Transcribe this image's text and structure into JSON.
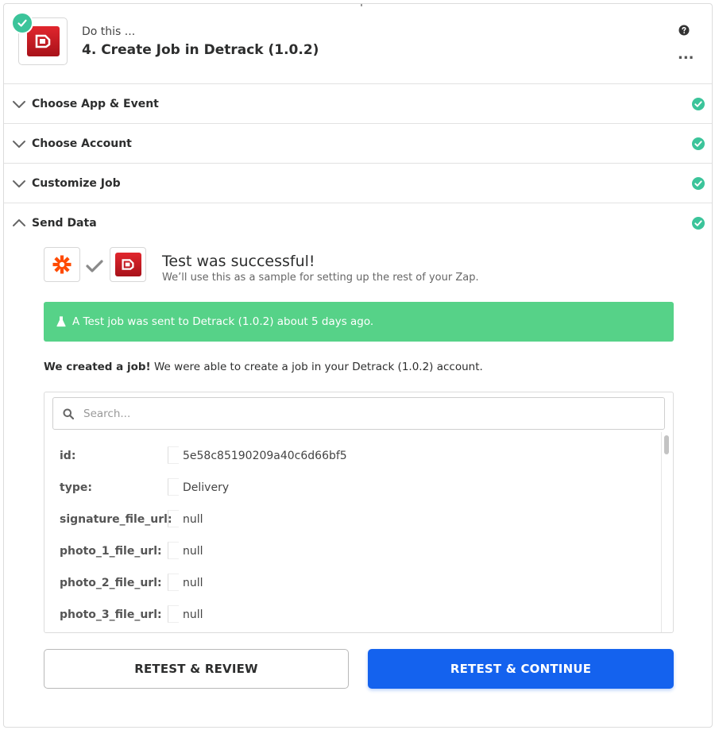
{
  "step": {
    "prefix": "Do this ...",
    "title": "4. Create Job in Detrack (1.0.2)",
    "more_label": "..."
  },
  "sections": [
    {
      "label": "Choose App & Event",
      "state": "collapsed",
      "complete": true
    },
    {
      "label": "Choose Account",
      "state": "collapsed",
      "complete": true
    },
    {
      "label": "Customize Job",
      "state": "collapsed",
      "complete": true
    },
    {
      "label": "Send Data",
      "state": "expanded",
      "complete": true
    }
  ],
  "send_data": {
    "success_title": "Test was successful!",
    "success_subtitle": "We’ll use this as a sample for setting up the rest of your Zap.",
    "banner_text": "A Test job was sent to Detrack (1.0.2) about 5 days ago.",
    "created_bold": "We created a job!",
    "created_rest": " We were able to create a job in your Detrack (1.0.2) account.",
    "search_placeholder": "Search...",
    "fields": [
      {
        "key": "id:",
        "value": "5e58c85190209a40c6d66bf5"
      },
      {
        "key": "type:",
        "value": "Delivery"
      },
      {
        "key": "signature_file_url:",
        "value": "null"
      },
      {
        "key": "photo_1_file_url:",
        "value": "null"
      },
      {
        "key": "photo_2_file_url:",
        "value": "null"
      },
      {
        "key": "photo_3_file_url:",
        "value": "null"
      }
    ]
  },
  "buttons": {
    "retest_review": "RETEST & REVIEW",
    "retest_continue": "RETEST & CONTINUE"
  },
  "colors": {
    "success_green": "#3bc49a",
    "banner_green": "#56d288",
    "primary_blue": "#1462ee",
    "detrack_red": "#d01f27",
    "zapier_orange": "#ff4a00"
  }
}
